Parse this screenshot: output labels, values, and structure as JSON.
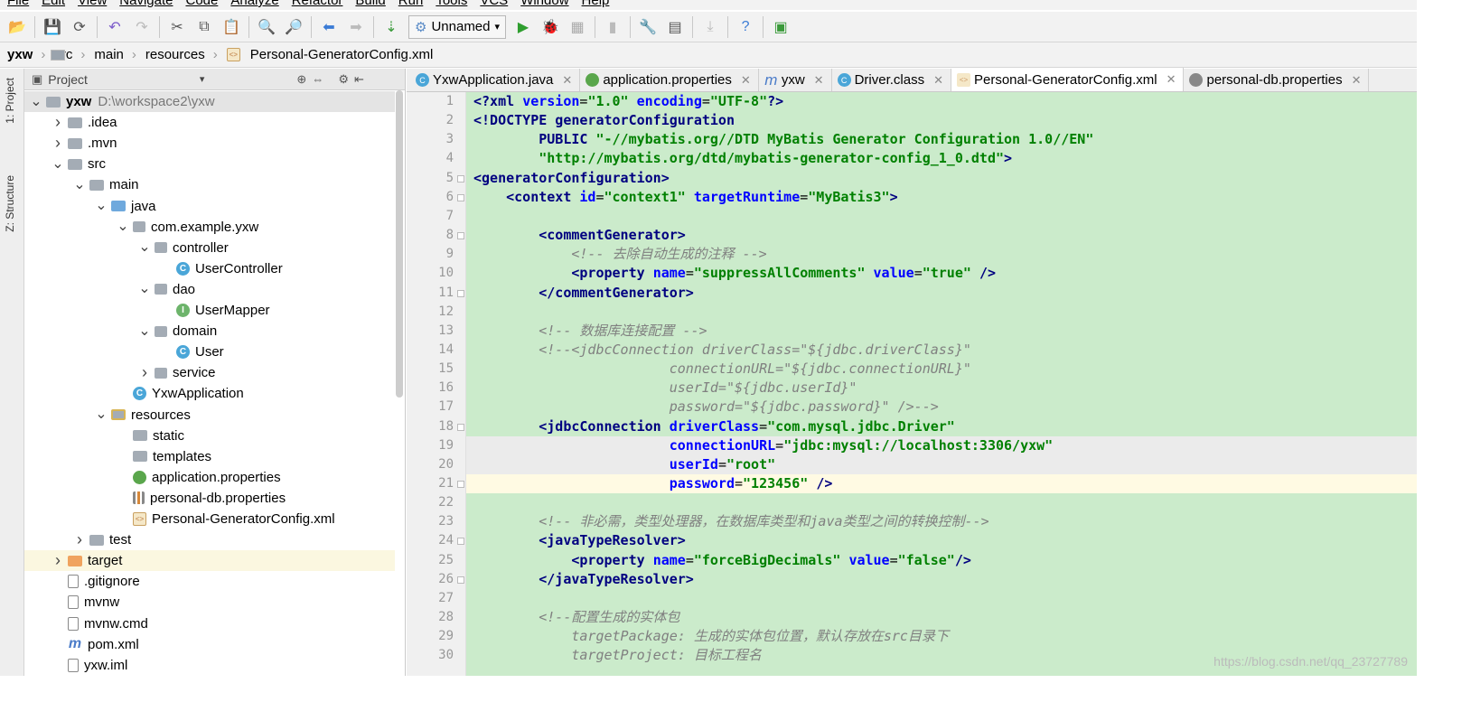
{
  "menu": [
    "File",
    "Edit",
    "View",
    "Navigate",
    "Code",
    "Analyze",
    "Refactor",
    "Build",
    "Run",
    "Tools",
    "VCS",
    "Window",
    "Help"
  ],
  "toolbar": {
    "run_config": "Unnamed"
  },
  "breadcrumb": [
    "yxw",
    "src",
    "main",
    "resources",
    "Personal-GeneratorConfig.xml"
  ],
  "side_tabs": {
    "project": "1: Project",
    "structure": "Z: Structure"
  },
  "project_panel": {
    "title": "Project"
  },
  "tree": [
    {
      "label": "yxw",
      "meta": "D:\\workspace2\\yxw",
      "bold": true
    },
    {
      "label": ".idea"
    },
    {
      "label": ".mvn"
    },
    {
      "label": "src"
    },
    {
      "label": "main"
    },
    {
      "label": "java"
    },
    {
      "label": "com.example.yxw"
    },
    {
      "label": "controller"
    },
    {
      "label": "UserController"
    },
    {
      "label": "dao"
    },
    {
      "label": "UserMapper"
    },
    {
      "label": "domain"
    },
    {
      "label": "User"
    },
    {
      "label": "service"
    },
    {
      "label": "YxwApplication"
    },
    {
      "label": "resources"
    },
    {
      "label": "static"
    },
    {
      "label": "templates"
    },
    {
      "label": "application.properties"
    },
    {
      "label": "personal-db.properties"
    },
    {
      "label": "Personal-GeneratorConfig.xml"
    },
    {
      "label": "test"
    },
    {
      "label": "target"
    },
    {
      "label": ".gitignore"
    },
    {
      "label": "mvnw"
    },
    {
      "label": "mvnw.cmd"
    },
    {
      "label": "pom.xml"
    },
    {
      "label": "yxw.iml"
    }
  ],
  "tabs": [
    {
      "label": "YxwApplication.java"
    },
    {
      "label": "application.properties"
    },
    {
      "label": "yxw"
    },
    {
      "label": "Driver.class"
    },
    {
      "label": "Personal-GeneratorConfig.xml",
      "active": true
    },
    {
      "label": "personal-db.properties"
    }
  ],
  "line_numbers": [
    "1",
    "2",
    "3",
    "4",
    "5",
    "6",
    "7",
    "8",
    "9",
    "10",
    "11",
    "12",
    "13",
    "14",
    "15",
    "16",
    "17",
    "18",
    "19",
    "20",
    "21",
    "22",
    "23",
    "24",
    "25",
    "26",
    "27",
    "28",
    "29",
    "30"
  ],
  "code": [
    [
      [
        "tag",
        "<?xml "
      ],
      [
        "attr",
        "version"
      ],
      [
        "plain",
        "="
      ],
      [
        "val",
        "\"1.0\""
      ],
      [
        "plain",
        " "
      ],
      [
        "attr",
        "encoding"
      ],
      [
        "plain",
        "="
      ],
      [
        "val",
        "\"UTF-8\""
      ],
      [
        "tag",
        "?>"
      ]
    ],
    [
      [
        "tag",
        "<!DOCTYPE generatorConfiguration"
      ]
    ],
    [
      [
        "plain",
        "        "
      ],
      [
        "tag",
        "PUBLIC "
      ],
      [
        "val",
        "\"-//mybatis.org//DTD MyBatis Generator Configuration 1.0//EN\""
      ]
    ],
    [
      [
        "plain",
        "        "
      ],
      [
        "val",
        "\"http://mybatis.org/dtd/mybatis-generator-config_1_0.dtd\""
      ],
      [
        "tag",
        ">"
      ]
    ],
    [
      [
        "tag",
        "<generatorConfiguration>"
      ]
    ],
    [
      [
        "plain",
        "    "
      ],
      [
        "tag",
        "<context "
      ],
      [
        "attr",
        "id"
      ],
      [
        "plain",
        "="
      ],
      [
        "val",
        "\"context1\""
      ],
      [
        "plain",
        " "
      ],
      [
        "attr",
        "targetRuntime"
      ],
      [
        "plain",
        "="
      ],
      [
        "val",
        "\"MyBatis3\""
      ],
      [
        "tag",
        ">"
      ]
    ],
    [],
    [
      [
        "plain",
        "        "
      ],
      [
        "tag",
        "<commentGenerator>"
      ]
    ],
    [
      [
        "plain",
        "            "
      ],
      [
        "cmt",
        "<!-- 去除自动生成的注释 -->"
      ]
    ],
    [
      [
        "plain",
        "            "
      ],
      [
        "tag",
        "<property "
      ],
      [
        "attr",
        "name"
      ],
      [
        "plain",
        "="
      ],
      [
        "val",
        "\"suppressAllComments\""
      ],
      [
        "plain",
        " "
      ],
      [
        "attr",
        "value"
      ],
      [
        "plain",
        "="
      ],
      [
        "val",
        "\"true\""
      ],
      [
        "plain",
        " "
      ],
      [
        "tag",
        "/>"
      ]
    ],
    [
      [
        "plain",
        "        "
      ],
      [
        "tag",
        "</commentGenerator>"
      ]
    ],
    [],
    [
      [
        "plain",
        "        "
      ],
      [
        "cmt",
        "<!-- 数据库连接配置 -->"
      ]
    ],
    [
      [
        "plain",
        "        "
      ],
      [
        "cmt",
        "<!--<jdbcConnection driverClass=\"${jdbc.driverClass}\""
      ]
    ],
    [
      [
        "plain",
        "                        "
      ],
      [
        "cmt",
        "connectionURL=\"${jdbc.connectionURL}\""
      ]
    ],
    [
      [
        "plain",
        "                        "
      ],
      [
        "cmt",
        "userId=\"${jdbc.userId}\""
      ]
    ],
    [
      [
        "plain",
        "                        "
      ],
      [
        "cmt",
        "password=\"${jdbc.password}\" />-->"
      ]
    ],
    [
      [
        "plain",
        "        "
      ],
      [
        "tag",
        "<jdbcConnection "
      ],
      [
        "attr",
        "driverClass"
      ],
      [
        "plain",
        "="
      ],
      [
        "val",
        "\"com.mysql.jdbc.Driver\""
      ]
    ],
    [
      [
        "plain",
        "                        "
      ],
      [
        "attr",
        "connectionURL"
      ],
      [
        "plain",
        "="
      ],
      [
        "val",
        "\"jdbc:mysql://localhost:3306/yxw\""
      ]
    ],
    [
      [
        "plain",
        "                        "
      ],
      [
        "attr",
        "userId"
      ],
      [
        "plain",
        "="
      ],
      [
        "val",
        "\"root\""
      ]
    ],
    [
      [
        "plain",
        "                        "
      ],
      [
        "attr",
        "password"
      ],
      [
        "plain",
        "="
      ],
      [
        "val",
        "\"123456\""
      ],
      [
        "plain",
        " "
      ],
      [
        "tag",
        "/>"
      ]
    ],
    [],
    [
      [
        "plain",
        "        "
      ],
      [
        "cmt",
        "<!-- 非必需，类型处理器，在数据库类型和java类型之间的转换控制-->"
      ]
    ],
    [
      [
        "plain",
        "        "
      ],
      [
        "tag",
        "<javaTypeResolver>"
      ]
    ],
    [
      [
        "plain",
        "            "
      ],
      [
        "tag",
        "<property "
      ],
      [
        "attr",
        "name"
      ],
      [
        "plain",
        "="
      ],
      [
        "val",
        "\"forceBigDecimals\""
      ],
      [
        "plain",
        " "
      ],
      [
        "attr",
        "value"
      ],
      [
        "plain",
        "="
      ],
      [
        "val",
        "\"false\""
      ],
      [
        "tag",
        "/>"
      ]
    ],
    [
      [
        "plain",
        "        "
      ],
      [
        "tag",
        "</javaTypeResolver>"
      ]
    ],
    [],
    [
      [
        "plain",
        "        "
      ],
      [
        "cmt",
        "<!--配置生成的实体包"
      ]
    ],
    [
      [
        "plain",
        "            "
      ],
      [
        "cmt",
        "targetPackage: 生成的实体包位置，默认存放在src目录下"
      ]
    ],
    [
      [
        "plain",
        "            "
      ],
      [
        "cmt",
        "targetProject: 目标工程名"
      ]
    ]
  ],
  "watermark": "https://blog.csdn.net/qq_23727789"
}
